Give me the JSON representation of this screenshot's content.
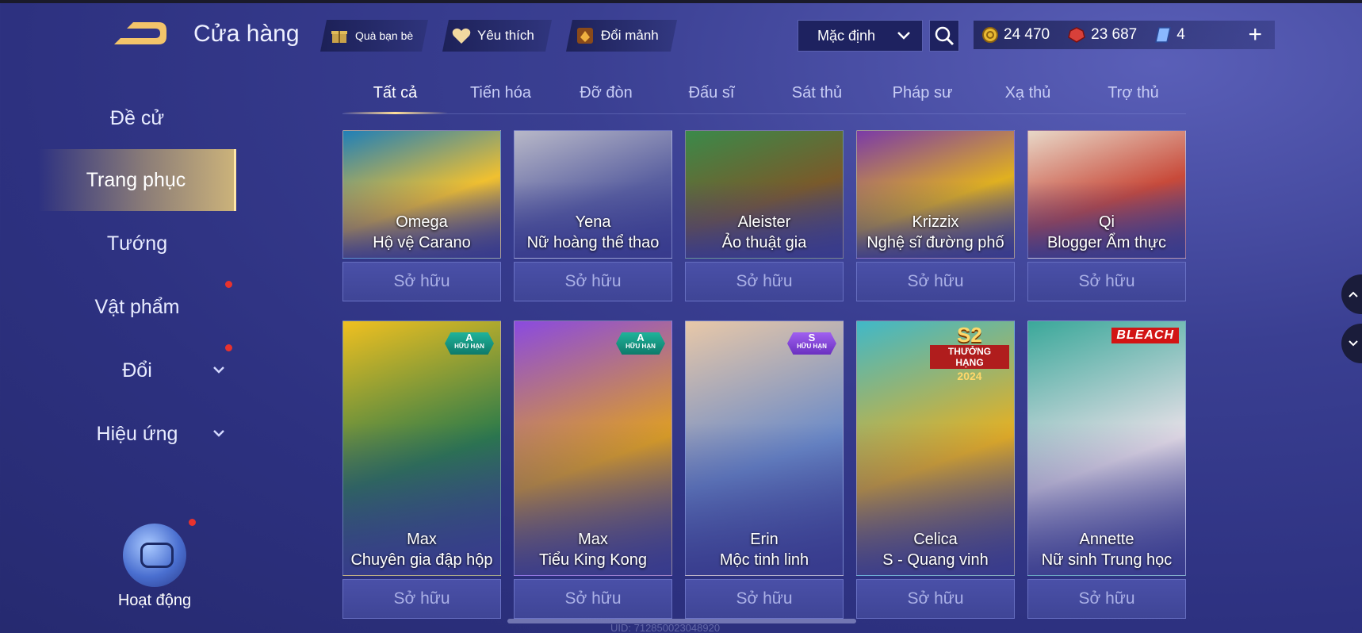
{
  "header": {
    "title": "Cửa hàng",
    "buttons": {
      "gift": "Quà bạn bè",
      "favorite": "Yêu thích",
      "exchange": "Đổi mảnh"
    },
    "sort": {
      "selected": "Mặc định"
    },
    "currencies": {
      "gold": "24 470",
      "ruby": "23 687",
      "voucher": "4"
    },
    "plus": "+"
  },
  "tabs": [
    "Tất cả",
    "Tiến hóa",
    "Đỡ đòn",
    "Đấu sĩ",
    "Sát thủ",
    "Pháp sư",
    "Xạ thủ",
    "Trợ thủ"
  ],
  "sidebar": {
    "items": [
      {
        "label": "Đề cử"
      },
      {
        "label": "Trang phục"
      },
      {
        "label": "Tướng"
      },
      {
        "label": "Vật phẩm"
      },
      {
        "label": "Đổi"
      },
      {
        "label": "Hiệu ứng"
      }
    ],
    "activity_label": "Hoạt động"
  },
  "row1": [
    {
      "hero": "Omega",
      "skin": "Hộ vệ Carano",
      "status": "Sở hữu",
      "colors": [
        "#1f7fb8",
        "#f0c030"
      ]
    },
    {
      "hero": "Yena",
      "skin": "Nữ hoàng thể thao",
      "status": "Sở hữu",
      "colors": [
        "#b8b8c8",
        "#5a60a0"
      ]
    },
    {
      "hero": "Aleister",
      "skin": "Ảo thuật gia",
      "status": "Sở hữu",
      "colors": [
        "#3a8a4a",
        "#7a5a2a"
      ]
    },
    {
      "hero": "Krizzix",
      "skin": "Nghệ sĩ đường phố",
      "status": "Sở hữu",
      "colors": [
        "#7a3aa8",
        "#e0b020"
      ]
    },
    {
      "hero": "Qi",
      "skin": "Blogger Ẩm thực",
      "status": "Sở hữu",
      "colors": [
        "#e8d8c8",
        "#c84a3a"
      ]
    }
  ],
  "row2": [
    {
      "hero": "Max",
      "skin": "Chuyên gia đập hộp",
      "status": "Sở hữu",
      "badge": "A",
      "badge_sub": "HỮU HẠN",
      "colors": [
        "#f0c020",
        "#2a7a4a"
      ]
    },
    {
      "hero": "Max",
      "skin": "Tiểu King Kong",
      "status": "Sở hữu",
      "badge": "A",
      "badge_sub": "HỮU HẠN",
      "colors": [
        "#8a4ae0",
        "#e0a020"
      ]
    },
    {
      "hero": "Erin",
      "skin": "Mộc tinh linh",
      "status": "Sở hữu",
      "badge": "S",
      "badge_sub": "HỮU HẠN",
      "colors": [
        "#e8c8a8",
        "#6a8ac8"
      ]
    },
    {
      "hero": "Celica",
      "skin": "S - Quang vinh",
      "status": "Sở hữu",
      "colors": [
        "#40b8c8",
        "#e8b020"
      ],
      "event_badge": {
        "big": "S2",
        "mid": "THƯỞNG HẠNG",
        "year": "2024"
      }
    },
    {
      "hero": "Annette",
      "skin": "Nữ sinh Trung học",
      "status": "Sở hữu",
      "colors": [
        "#3aa89a",
        "#e8e0e8"
      ],
      "event_badge": {
        "brand": "BLEACH"
      }
    }
  ],
  "uid": "UID: 712850023048920"
}
